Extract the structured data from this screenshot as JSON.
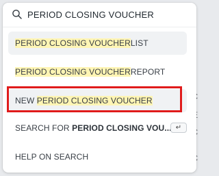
{
  "search": {
    "value": "PERIOD CLOSING VOUCHER",
    "placeholder": ""
  },
  "results": [
    {
      "highlight": "PERIOD CLOSING VOUCHER",
      "suffix": " LIST"
    },
    {
      "highlight": "PERIOD CLOSING VOUCHER",
      "suffix": " REPORT"
    },
    {
      "prefix": "NEW ",
      "highlight": "PERIOD CLOSING VOUCHER"
    },
    {
      "prefix": "SEARCH FOR ",
      "strong": "PERIOD CLOSING VOU...",
      "key": "↵"
    },
    {
      "label": "HELP ON SEARCH"
    }
  ],
  "background_fragments": [
    "C",
    "E",
    "C",
    "C"
  ],
  "colors": {
    "highlight": "#fff5b4",
    "callout": "#e01b1b",
    "active_row": "#f0f2f4"
  },
  "icons": {
    "search": "search-icon",
    "enter": "enter-key-icon"
  }
}
